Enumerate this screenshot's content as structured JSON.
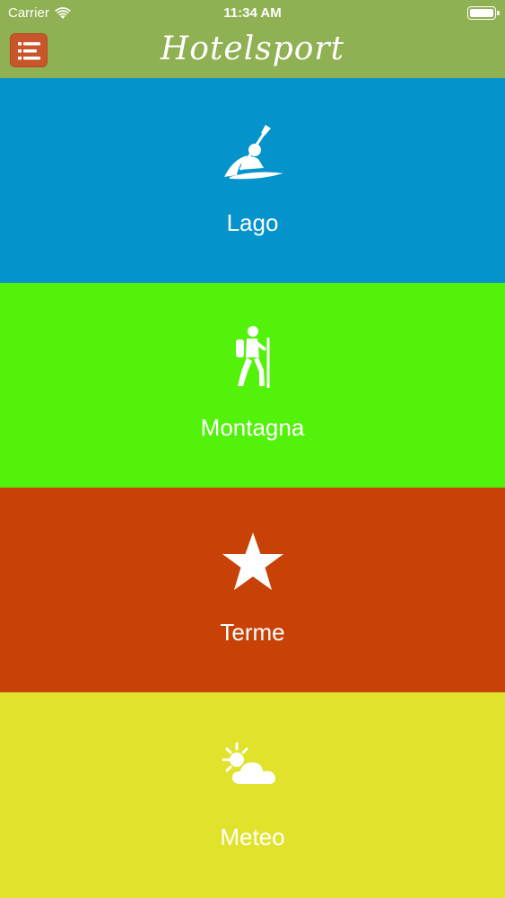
{
  "status_bar": {
    "carrier": "Carrier",
    "time": "11:34 AM"
  },
  "nav": {
    "title": "Hotelsport",
    "menu_icon": "list-icon",
    "background_color": "#8fb153",
    "menu_button_color": "#c9552b"
  },
  "tiles": [
    {
      "label": "Lago",
      "icon": "kayak-icon",
      "color": "#0493cb"
    },
    {
      "label": "Montagna",
      "icon": "hiker-icon",
      "color": "#53f20b"
    },
    {
      "label": "Terme",
      "icon": "star-icon",
      "color": "#c84207"
    },
    {
      "label": "Meteo",
      "icon": "partly-cloudy-icon",
      "color": "#e0e22b"
    }
  ]
}
